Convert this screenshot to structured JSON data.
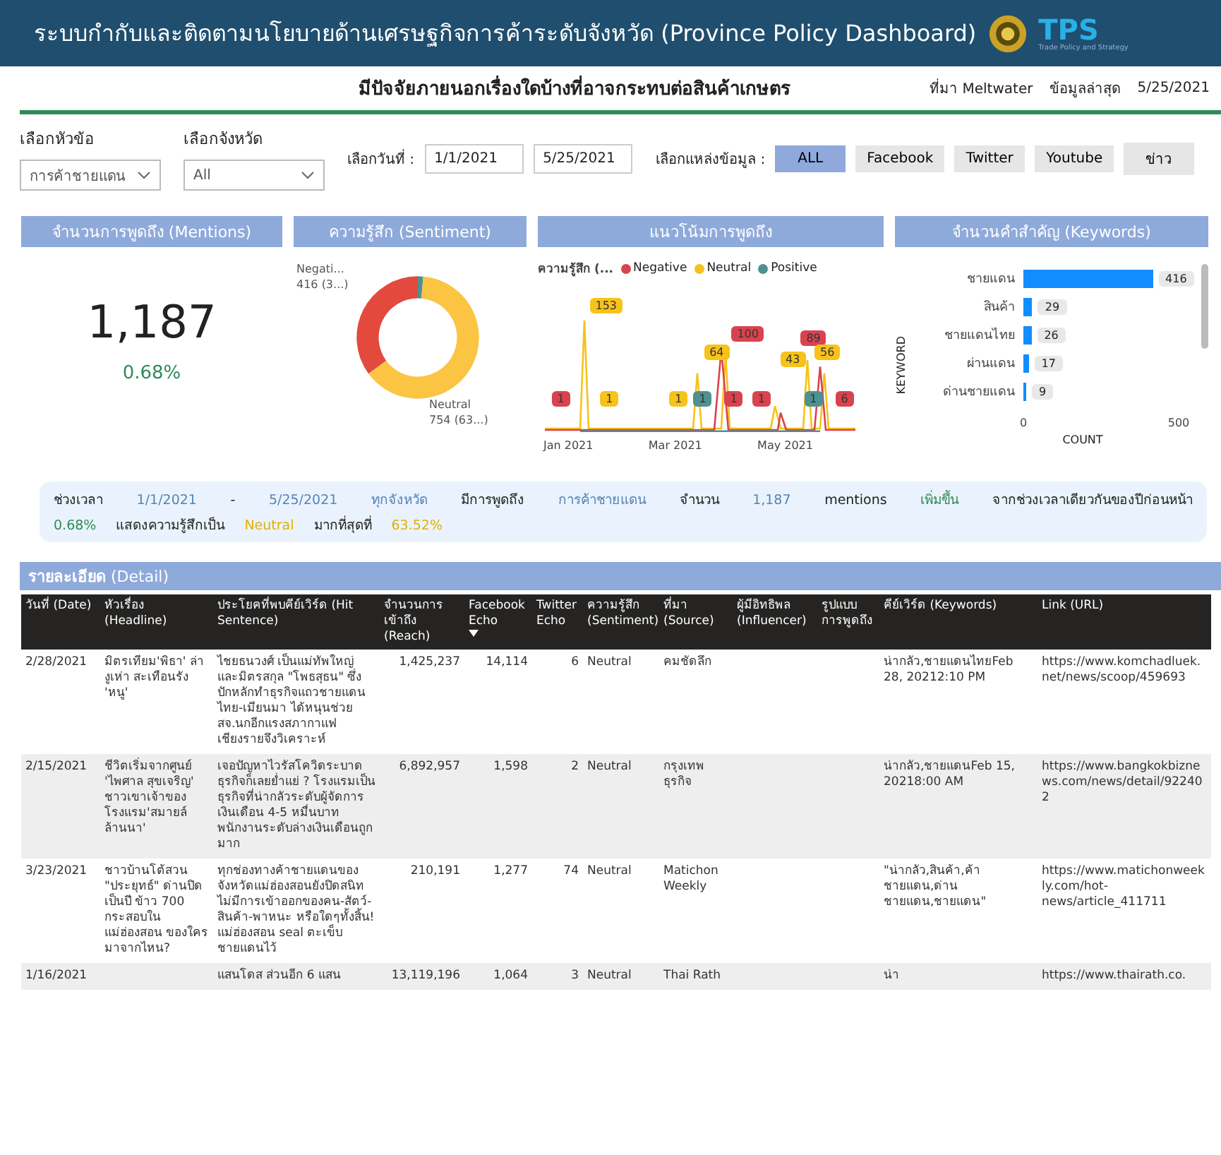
{
  "header": {
    "title": "ระบบกำกับและติดตามนโยบายด้านเศรษฐกิจการค้าระดับจังหวัด (Province Policy Dashboard)",
    "logo_text": "TPS",
    "logo_subtitle": "Trade Policy and Strategy"
  },
  "subheader": {
    "question": "มีปัจจัยภายนอกเรื่องใดบ้างที่อาจกระทบต่อสินค้าเกษตร",
    "source": "ที่มา Meltwater",
    "updated_label": "ข้อมูลล่าสุด",
    "updated_date": "5/25/2021"
  },
  "filters": {
    "topic": {
      "label": "เลือกหัวข้อ",
      "value": "การค้าชายแดน"
    },
    "province": {
      "label": "เลือกจังหวัด",
      "value": "All"
    },
    "date": {
      "label": "เลือกวันที่ :",
      "start": "1/1/2021",
      "end": "5/25/2021"
    },
    "source": {
      "label": "เลือกแหล่งข้อมูล :",
      "options": [
        {
          "label": "ALL",
          "selected": true
        },
        {
          "label": "Facebook",
          "selected": false
        },
        {
          "label": "Twitter",
          "selected": false
        },
        {
          "label": "Youtube",
          "selected": false
        },
        {
          "label": "ข่าว",
          "selected": false
        }
      ]
    }
  },
  "mentions": {
    "title": "จำนวนการพูดถึง (Mentions)",
    "value": "1,187",
    "change": "0.68%"
  },
  "sentiment": {
    "title": "ความรู้สึก (Sentiment)",
    "labels": [
      {
        "name": "Negati...",
        "detail": "416 (3...)"
      },
      {
        "name": "Neutral",
        "detail": "754 (63...)"
      }
    ],
    "chart_data": {
      "type": "donut",
      "values": [
        35.05,
        63.52,
        1.43
      ]
    }
  },
  "trend": {
    "title": "แนวโน้มการพูดถึง",
    "legend_title": "ความรู้สึก (...",
    "legend": [
      {
        "name": "Negative",
        "kind": "negative",
        "color": "#d9434e"
      },
      {
        "name": "Neutral",
        "kind": "neutral",
        "color": "#f7c21a"
      },
      {
        "name": "Positive",
        "kind": "positive",
        "color": "#4f9091"
      }
    ],
    "x_labels": [
      "Jan 2021",
      "Mar 2021",
      "May 2021"
    ],
    "data_labels": [
      {
        "value": "1",
        "kind": "negative"
      },
      {
        "value": "153",
        "kind": "neutral"
      },
      {
        "value": "1",
        "kind": "neutral"
      },
      {
        "value": "1",
        "kind": "neutral"
      },
      {
        "value": "1",
        "kind": "positive"
      },
      {
        "value": "1",
        "kind": "negative"
      },
      {
        "value": "1",
        "kind": "negative"
      },
      {
        "value": "64",
        "kind": "neutral"
      },
      {
        "value": "100",
        "kind": "negative"
      },
      {
        "value": "43",
        "kind": "neutral"
      },
      {
        "value": "89",
        "kind": "negative"
      },
      {
        "value": "56",
        "kind": "neutral"
      },
      {
        "value": "1",
        "kind": "positive"
      },
      {
        "value": "6",
        "kind": "negative"
      }
    ]
  },
  "keywords": {
    "title": "จำนวนคำสำคัญ (Keywords)",
    "chart_data": {
      "type": "bar",
      "orientation": "horizontal",
      "categories": [
        "ชายแดน",
        "สินค้า",
        "ชายแดนไทย",
        "ผ่านแดน",
        "ด่านชายแดน"
      ],
      "values": [
        416,
        29,
        26,
        17,
        9
      ],
      "xlabel": "COUNT",
      "ylabel": "KEYWORD",
      "xticks": [
        0,
        500
      ],
      "xlim": [
        0,
        500
      ],
      "data_labels": true
    }
  },
  "summary": {
    "lines": [
      [
        {
          "text": "ช่วงเวลา",
          "kind": "label"
        },
        {
          "text": "1/1/2021",
          "kind": "value"
        },
        {
          "text": "-",
          "kind": "label"
        },
        {
          "text": "5/25/2021",
          "kind": "value"
        },
        {
          "text": "ทุกจังหวัด",
          "kind": "value"
        },
        {
          "text": "มีการพูดถึง",
          "kind": "label"
        },
        {
          "text": "การค้าชายแดน",
          "kind": "value"
        },
        {
          "text": "จำนวน",
          "kind": "label"
        },
        {
          "text": "1,187",
          "kind": "value"
        },
        {
          "text": "mentions",
          "kind": "label"
        },
        {
          "text": "เพิ่มขึ้น",
          "kind": "positive"
        },
        {
          "text": "จากช่วงเวลาเดียวกันของปีก่อนหน้า",
          "kind": "label"
        }
      ],
      [
        {
          "text": "0.68%",
          "kind": "positive"
        },
        {
          "text": "แสดงความรู้สึกเป็น",
          "kind": "label"
        },
        {
          "text": "Neutral",
          "kind": "highlight"
        },
        {
          "text": "มากที่สุดที่",
          "kind": "label"
        },
        {
          "text": "63.52%",
          "kind": "highlight"
        }
      ]
    ]
  },
  "detail": {
    "title": "**รายละเอียด** (Detail)",
    "columns": [
      {
        "label": "วันที่ (Date)",
        "sorted": false
      },
      {
        "label": "หัวเรื่อง (Headline)",
        "sorted": false
      },
      {
        "label": "ประโยคที่พบคีย์เวิร์ด (Hit Sentence)",
        "sorted": false
      },
      {
        "label": "จำนวนการเข้าถึง (Reach)",
        "sorted": false
      },
      {
        "label": "Facebook Echo",
        "sorted": true
      },
      {
        "label": "Twitter Echo",
        "sorted": false
      },
      {
        "label": "ความรู้สึก (Sentiment)",
        "sorted": false
      },
      {
        "label": "ที่มา (Source)",
        "sorted": false
      },
      {
        "label": "ผู้มีอิทธิพล (Influencer)",
        "sorted": false
      },
      {
        "label": "รูปแบบการพูดถึง",
        "sorted": false
      },
      {
        "label": "คีย์เวิร์ด (Keywords)",
        "sorted": false
      },
      {
        "label": "Link (URL)",
        "sorted": false
      }
    ],
    "rows": [
      [
        "2/28/2021",
        "มิตรเทียม'พิธา' ล่างูเห่า สะเทือนรัง 'หนู'",
        "ไชยธนวงศ์ เป็นแม่ทัพใหญ่ และมิตรสกุล \"โพธสุธน\" ซึ่งปักหลักทำธุรกิจแถวชายแดนไทย-เมียนมา ได้หนุนช่วย สจ.นกอีกแรงสภากาแฟเชียงรายจึงวิเคราะห์",
        "1,425,237",
        "14,114",
        "6",
        "Neutral",
        "คมชัดลึก",
        null,
        null,
        "น่ากลัว,ชายแดนไทยFeb 28, 20212:10 PM",
        "https://www.komchadluek.net/news/scoop/459693"
      ],
      [
        "2/15/2021",
        "ชีวิตเริ่มจากศูนย์ 'ไพศาล สุขเจริญ' ชาวเขาเจ้าของโรงแรม'สมายล์ ล้านนา'",
        "เจอปัญหาไวรัสโควิดระบาด ธุรกิจก็เลยย่ำแย่ ? โรงแรมเป็นธุรกิจที่น่ากลัวระดับผู้จัดการเงินเดือน 4-5 หมื่นบาท พนักงานระดับล่างเงินเดือนถูกมาก",
        "6,892,957",
        "1,598",
        "2",
        "Neutral",
        "กรุงเทพธุรกิจ",
        null,
        null,
        "น่ากลัว,ชายแดนFeb 15, 20218:00 AM",
        "https://www.bangkokbiznews.com/news/detail/922402"
      ],
      [
        "3/23/2021",
        "ชาวบ้านโต้สวน \"ประยุทธ์\" ด่านปิดเป็นปี ข้าว 700 กระสอบในแม่ฮ่องสอน ของใครมาจากไหน?",
        "ทุกช่องทางค้าชายแดนของจังหวัดแม่ฮ่องสอนยังปิดสนิท ไม่มีการเข้าออกของคน-สัตว์-สินค้า-พาหนะ หรือใดๆทั้งสิ้น! แม่ฮ่องสอน seal ตะเข็บชายแดนไว้",
        "210,191",
        "1,277",
        "74",
        "Neutral",
        "Matichon Weekly",
        null,
        null,
        "\"น่ากลัว,สินค้า,ค้าชายแดน,ด่านชายแดน,ชายแดน\"",
        "https://www.matichonweekly.com/hot-news/article_411711"
      ],
      [
        "1/16/2021",
        null,
        "แสนโดส ส่วนอีก 6 แสน",
        "13,119,196",
        "1,064",
        "3",
        "Neutral",
        "Thai Rath",
        null,
        null,
        "น่า",
        "https://www.thairath.co."
      ]
    ]
  }
}
